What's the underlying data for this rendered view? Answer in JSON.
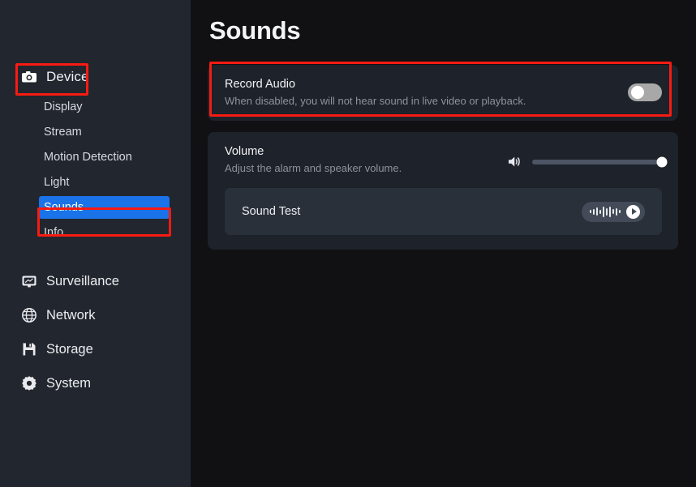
{
  "sidebar": {
    "device": {
      "label": "Device",
      "icon": "camera-icon",
      "items": [
        {
          "label": "Display",
          "selected": false
        },
        {
          "label": "Stream",
          "selected": false
        },
        {
          "label": "Motion Detection",
          "selected": false
        },
        {
          "label": "Light",
          "selected": false
        },
        {
          "label": "Sounds",
          "selected": true
        },
        {
          "label": "Info",
          "selected": false
        }
      ]
    },
    "roots": [
      {
        "label": "Surveillance",
        "icon": "monitor-icon"
      },
      {
        "label": "Network",
        "icon": "globe-icon"
      },
      {
        "label": "Storage",
        "icon": "floppy-disk-icon"
      },
      {
        "label": "System",
        "icon": "gear-icon"
      }
    ]
  },
  "main": {
    "title": "Sounds",
    "record_audio": {
      "title": "Record Audio",
      "description": "When disabled, you will not hear sound in live video or playback.",
      "toggle_state": "off"
    },
    "volume": {
      "title": "Volume",
      "description": "Adjust the alarm and speaker volume.",
      "speaker_icon": "speaker-icon",
      "level_percent": 100,
      "sound_test": {
        "label": "Sound Test",
        "play_icon": "play-icon",
        "waveform_icon": "waveform-icon"
      }
    }
  },
  "annotations": {
    "highlight_color": "#f81b12",
    "targets": [
      "Device",
      "Sounds",
      "Record Audio"
    ]
  },
  "colors": {
    "sidebar_bg": "#22262e",
    "content_bg": "#111113",
    "card_bg": "#1e222a",
    "inner_row_bg": "#2a303a",
    "selection_blue": "#1a73e8",
    "annotation_red": "#f81b12"
  }
}
